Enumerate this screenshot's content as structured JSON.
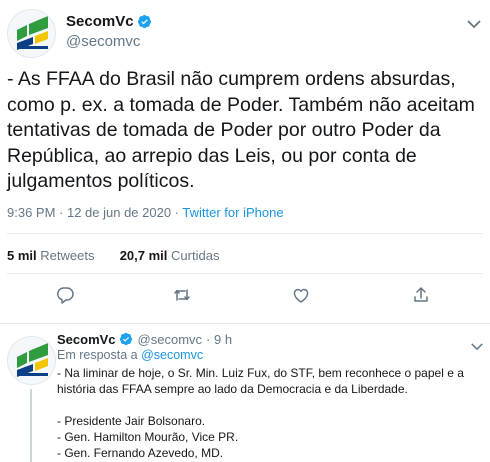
{
  "main_tweet": {
    "display_name": "SecomVc",
    "handle": "@secomvc",
    "text": "- As FFAA do Brasil não cumprem ordens absurdas, como p. ex. a tomada de Poder. Também não aceitam tentativas de tomada de Poder por outro Poder da República, ao arrepio das Leis, ou por conta de julgamentos políticos.",
    "timestamp": "9:36 PM · 12 de jun de 2020 · ",
    "source": "Twitter for iPhone",
    "retweets_count": "5 mil",
    "retweets_label": "Retweets",
    "likes_count": "20,7 mil",
    "likes_label": "Curtidas"
  },
  "reply_tweet": {
    "display_name": "SecomVc",
    "handle": "@secomvc",
    "time": "· 9 h",
    "in_reply_prefix": "Em resposta a ",
    "in_reply_handle": "@secomvc",
    "text": "- Na liminar de hoje, o Sr. Min. Luiz Fux, do STF, bem reconhece o papel e a história das FFAA sempre ao lado da Democracia e da Liberdade.\n\n- Presidente Jair Bolsonaro.\n- Gen. Hamilton Mourão, Vice PR.\n- Gen. Fernando Azevedo, MD."
  },
  "colors": {
    "verified": "#1da1f2",
    "link": "#1b95e0",
    "muted": "#657786",
    "icon": "#657786",
    "logo_green": "#2e9c3f",
    "logo_blue": "#0b3f86",
    "logo_yellow": "#f1c500"
  },
  "icons": [
    "verified-icon",
    "chevron-down-icon",
    "reply-icon",
    "retweet-icon",
    "like-icon",
    "share-icon"
  ]
}
